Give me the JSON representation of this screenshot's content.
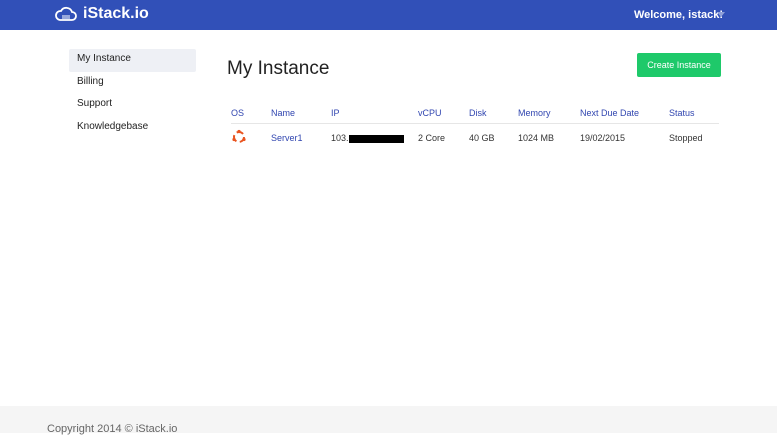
{
  "header": {
    "brand": "iStack.io",
    "welcome": "Welcome, istack!"
  },
  "sidebar": {
    "items": [
      {
        "label": "My Instance"
      },
      {
        "label": "Billing"
      },
      {
        "label": "Support"
      },
      {
        "label": "Knowledgebase"
      }
    ]
  },
  "main": {
    "title": "My Instance",
    "create_label": "Create Instance",
    "columns": [
      "OS",
      "Name",
      "IP",
      "vCPU",
      "Disk",
      "Memory",
      "Next Due Date",
      "Status"
    ],
    "rows": [
      {
        "name": "Server1",
        "ip": "103.",
        "vcpu": "2 Core",
        "disk": "40 GB",
        "memory": "1024 MB",
        "due": "19/02/2015",
        "status": "Stopped"
      }
    ]
  },
  "footer": {
    "copyright": "Copyright 2014 © iStack.io"
  },
  "colors": {
    "header": "#3150b8",
    "accent": "#1ec96a",
    "os_icon": "#e95420"
  }
}
